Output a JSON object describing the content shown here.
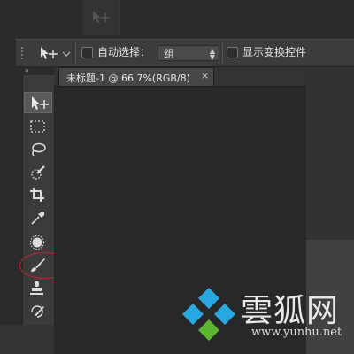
{
  "options_bar": {
    "auto_select_label": "自动选择：",
    "group_select_value": "组",
    "show_transform_label": "显示变换控件"
  },
  "toolbox": {
    "collapse_label": "»",
    "tools": [
      {
        "name": "move-tool",
        "icon": "move-icon",
        "active": true
      },
      {
        "name": "marquee-tool",
        "icon": "rect-marquee-icon"
      },
      {
        "name": "lasso-tool",
        "icon": "lasso-icon"
      },
      {
        "name": "quick-select-tool",
        "icon": "quick-select-icon"
      },
      {
        "name": "crop-tool",
        "icon": "crop-icon"
      },
      {
        "name": "eyedropper-tool",
        "icon": "eyedropper-icon"
      },
      {
        "name": "healing-brush-tool",
        "icon": "healing-icon"
      },
      {
        "name": "brush-tool",
        "icon": "brush-icon",
        "highlighted": true
      },
      {
        "name": "clone-stamp-tool",
        "icon": "stamp-icon"
      },
      {
        "name": "history-brush-tool",
        "icon": "history-brush-icon"
      }
    ]
  },
  "document": {
    "tab_title": "未标题-1 @ 66.7%(RGB/8)",
    "close_glyph": "×"
  },
  "watermark": {
    "brand": "雲狐网",
    "url": "www.yunhu.net"
  },
  "colors": {
    "highlight_circle": "#c0262a",
    "logo_blue": "#29a8e0",
    "logo_green": "#5cb531"
  }
}
